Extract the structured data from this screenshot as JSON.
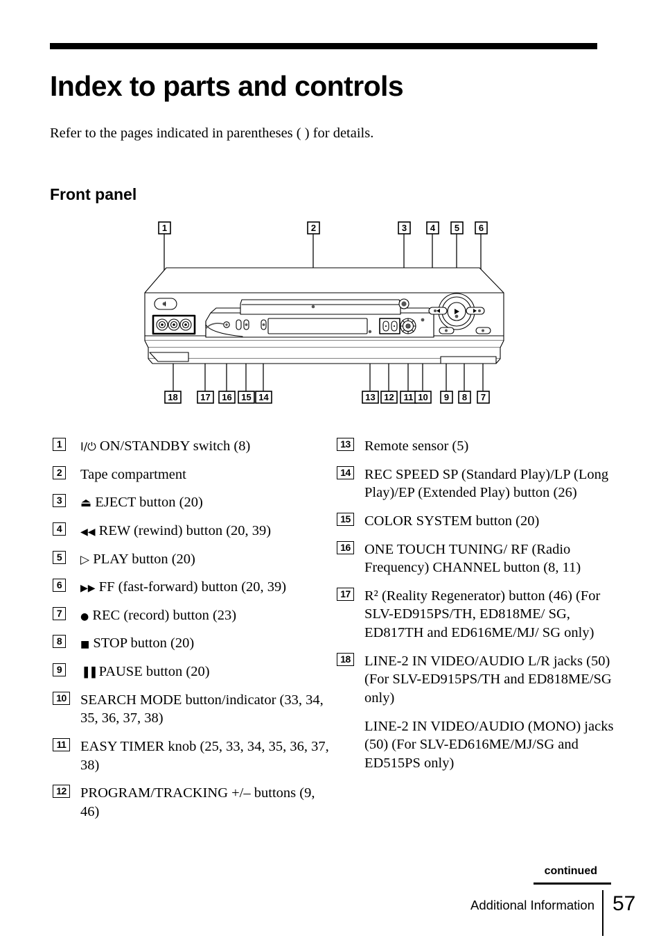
{
  "header": {
    "title": "Index to parts and controls",
    "intro": "Refer to the pages indicated in parentheses (   ) for details.",
    "section_title": "Front panel"
  },
  "diagram": {
    "caption": "Front panel illustration of VCR with numbered callouts",
    "callouts_top": [
      "1",
      "2",
      "3",
      "4",
      "5",
      "6"
    ],
    "callouts_bottom": [
      "18",
      "17",
      "16",
      "15",
      "14",
      "13",
      "12",
      "11",
      "10",
      "9",
      "8",
      "7"
    ]
  },
  "list_left": [
    {
      "num": "1",
      "lines": [
        {
          "glyph": "I/⏻",
          "text": " ON/STANDBY switch (8)"
        }
      ]
    },
    {
      "num": "2",
      "lines": [
        {
          "glyph": "",
          "text": "Tape compartment"
        }
      ]
    },
    {
      "num": "3",
      "lines": [
        {
          "glyph": "⏏",
          "text": " EJECT button (20)"
        }
      ]
    },
    {
      "num": "4",
      "lines": [
        {
          "glyph": "◀◀",
          "text": " REW (rewind) button (20, 39)"
        }
      ]
    },
    {
      "num": "5",
      "lines": [
        {
          "glyph": "▷",
          "text": " PLAY button (20)"
        }
      ]
    },
    {
      "num": "6",
      "lines": [
        {
          "glyph": "▶▶",
          "text": " FF (fast-forward) button (20, 39)"
        }
      ]
    },
    {
      "num": "7",
      "lines": [
        {
          "glyph": "●",
          "text": " REC (record) button (23)"
        }
      ]
    },
    {
      "num": "8",
      "lines": [
        {
          "glyph": "■",
          "text": " STOP button (20)"
        }
      ]
    },
    {
      "num": "9",
      "lines": [
        {
          "glyph": "▐▐",
          "text": " PAUSE button (20)"
        }
      ]
    },
    {
      "num": "10",
      "lines": [
        {
          "glyph": "",
          "text": "SEARCH MODE button/indicator (33, 34, 35, 36, 37, 38)"
        }
      ]
    },
    {
      "num": "11",
      "lines": [
        {
          "glyph": "",
          "text": "EASY TIMER knob (25, 33, 34, 35, 36, 37, 38)"
        }
      ]
    },
    {
      "num": "12",
      "lines": [
        {
          "glyph": "",
          "text": "PROGRAM/TRACKING +/– buttons (9, 46)"
        }
      ]
    }
  ],
  "list_right": [
    {
      "num": "13",
      "lines": [
        {
          "glyph": "",
          "text": "Remote sensor (5)"
        }
      ]
    },
    {
      "num": "14",
      "lines": [
        {
          "glyph": "",
          "text": "REC SPEED SP (Standard Play)/LP (Long Play)/EP (Extended Play) button (26)"
        }
      ]
    },
    {
      "num": "15",
      "lines": [
        {
          "glyph": "",
          "text": "COLOR SYSTEM button (20)"
        }
      ]
    },
    {
      "num": "16",
      "lines": [
        {
          "glyph": "",
          "text": "ONE TOUCH TUNING/ RF (Radio Frequency) CHANNEL button (8, 11)"
        }
      ]
    },
    {
      "num": "17",
      "lines": [
        {
          "glyph": "",
          "text": "R² (Reality Regenerator) button (46) (For SLV-ED915PS/TH, ED818ME/ SG, ED817TH and ED616ME/MJ/ SG only)"
        }
      ]
    },
    {
      "num": "18",
      "lines": [
        {
          "glyph": "",
          "text": "LINE-2 IN VIDEO/AUDIO L/R jacks (50) (For SLV-ED915PS/TH and ED818ME/SG only)"
        },
        {
          "glyph": "",
          "text": "LINE-2 IN VIDEO/AUDIO (MONO) jacks (50) (For SLV-ED616ME/MJ/SG and ED515PS only)"
        }
      ]
    }
  ],
  "footer": {
    "continued": "continued",
    "section": "Additional Information",
    "page_number": "57"
  }
}
